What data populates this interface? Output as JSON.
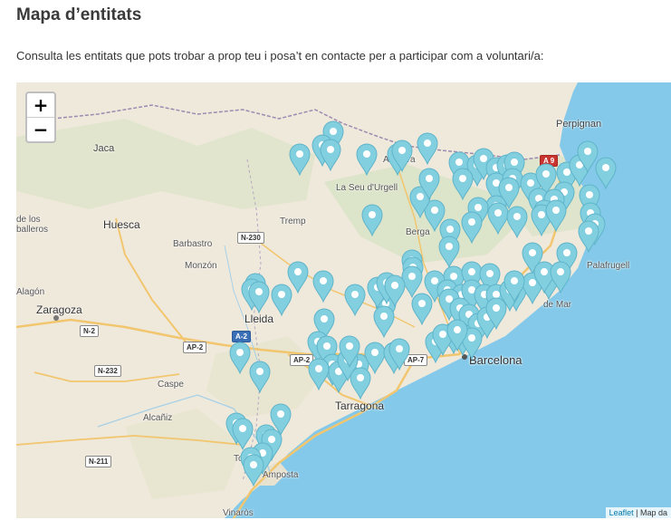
{
  "page": {
    "title": "Mapa d’entitats",
    "intro": "Consulta les entitats que pots trobar a prop teu i posa’t en contacte per a participar com a voluntari/a:"
  },
  "map": {
    "zoom_in": "+",
    "zoom_out": "−",
    "attribution": {
      "link": "Leaflet",
      "separator": " | ",
      "rest": "Map da"
    },
    "colors": {
      "land": "#efe9dc",
      "sea": "#84c9ea",
      "marker": "#82cfe0",
      "road": "#f2c66e"
    },
    "labels": [
      {
        "name": "perpignan",
        "text": "Perpignan"
      },
      {
        "name": "jaca",
        "text": "Jaca"
      },
      {
        "name": "la-seu",
        "text": "La Seu d'Urgell"
      },
      {
        "name": "andorra",
        "text": "Andorra"
      },
      {
        "name": "de-los",
        "text": "de los"
      },
      {
        "name": "balleros",
        "text": "balleros"
      },
      {
        "name": "huesca",
        "text": "Huesca"
      },
      {
        "name": "tremp",
        "text": "Tremp"
      },
      {
        "name": "berga",
        "text": "Berga"
      },
      {
        "name": "barbastro",
        "text": "Barbastro"
      },
      {
        "name": "monzon",
        "text": "Monzón"
      },
      {
        "name": "alagon",
        "text": "Alagón"
      },
      {
        "name": "zaragoza",
        "text": "Zaragoza"
      },
      {
        "name": "lleida",
        "text": "Lleida"
      },
      {
        "name": "caspe",
        "text": "Caspe"
      },
      {
        "name": "alcaniz",
        "text": "Alcañiz"
      },
      {
        "name": "tarragona",
        "text": "Tarragona"
      },
      {
        "name": "barcelona",
        "text": "Barcelona"
      },
      {
        "name": "tortosa",
        "text": "Tortosa"
      },
      {
        "name": "amposta",
        "text": "Amposta"
      },
      {
        "name": "vinaros",
        "text": "Vinaròs"
      },
      {
        "name": "de-mar",
        "text": "de Mar"
      },
      {
        "name": "palafrugell",
        "text": "Palafrugell"
      }
    ],
    "shields": [
      {
        "name": "a9",
        "text": "A 9"
      },
      {
        "name": "n230",
        "text": "N-230"
      },
      {
        "name": "n2",
        "text": "N-2"
      },
      {
        "name": "a2",
        "text": "A-2"
      },
      {
        "name": "ap2-a",
        "text": "AP-2"
      },
      {
        "name": "ap2-b",
        "text": "AP-2"
      },
      {
        "name": "ap7",
        "text": "AP-7"
      },
      {
        "name": "n232",
        "text": "N-232"
      },
      {
        "name": "n211",
        "text": "N-211"
      }
    ]
  }
}
